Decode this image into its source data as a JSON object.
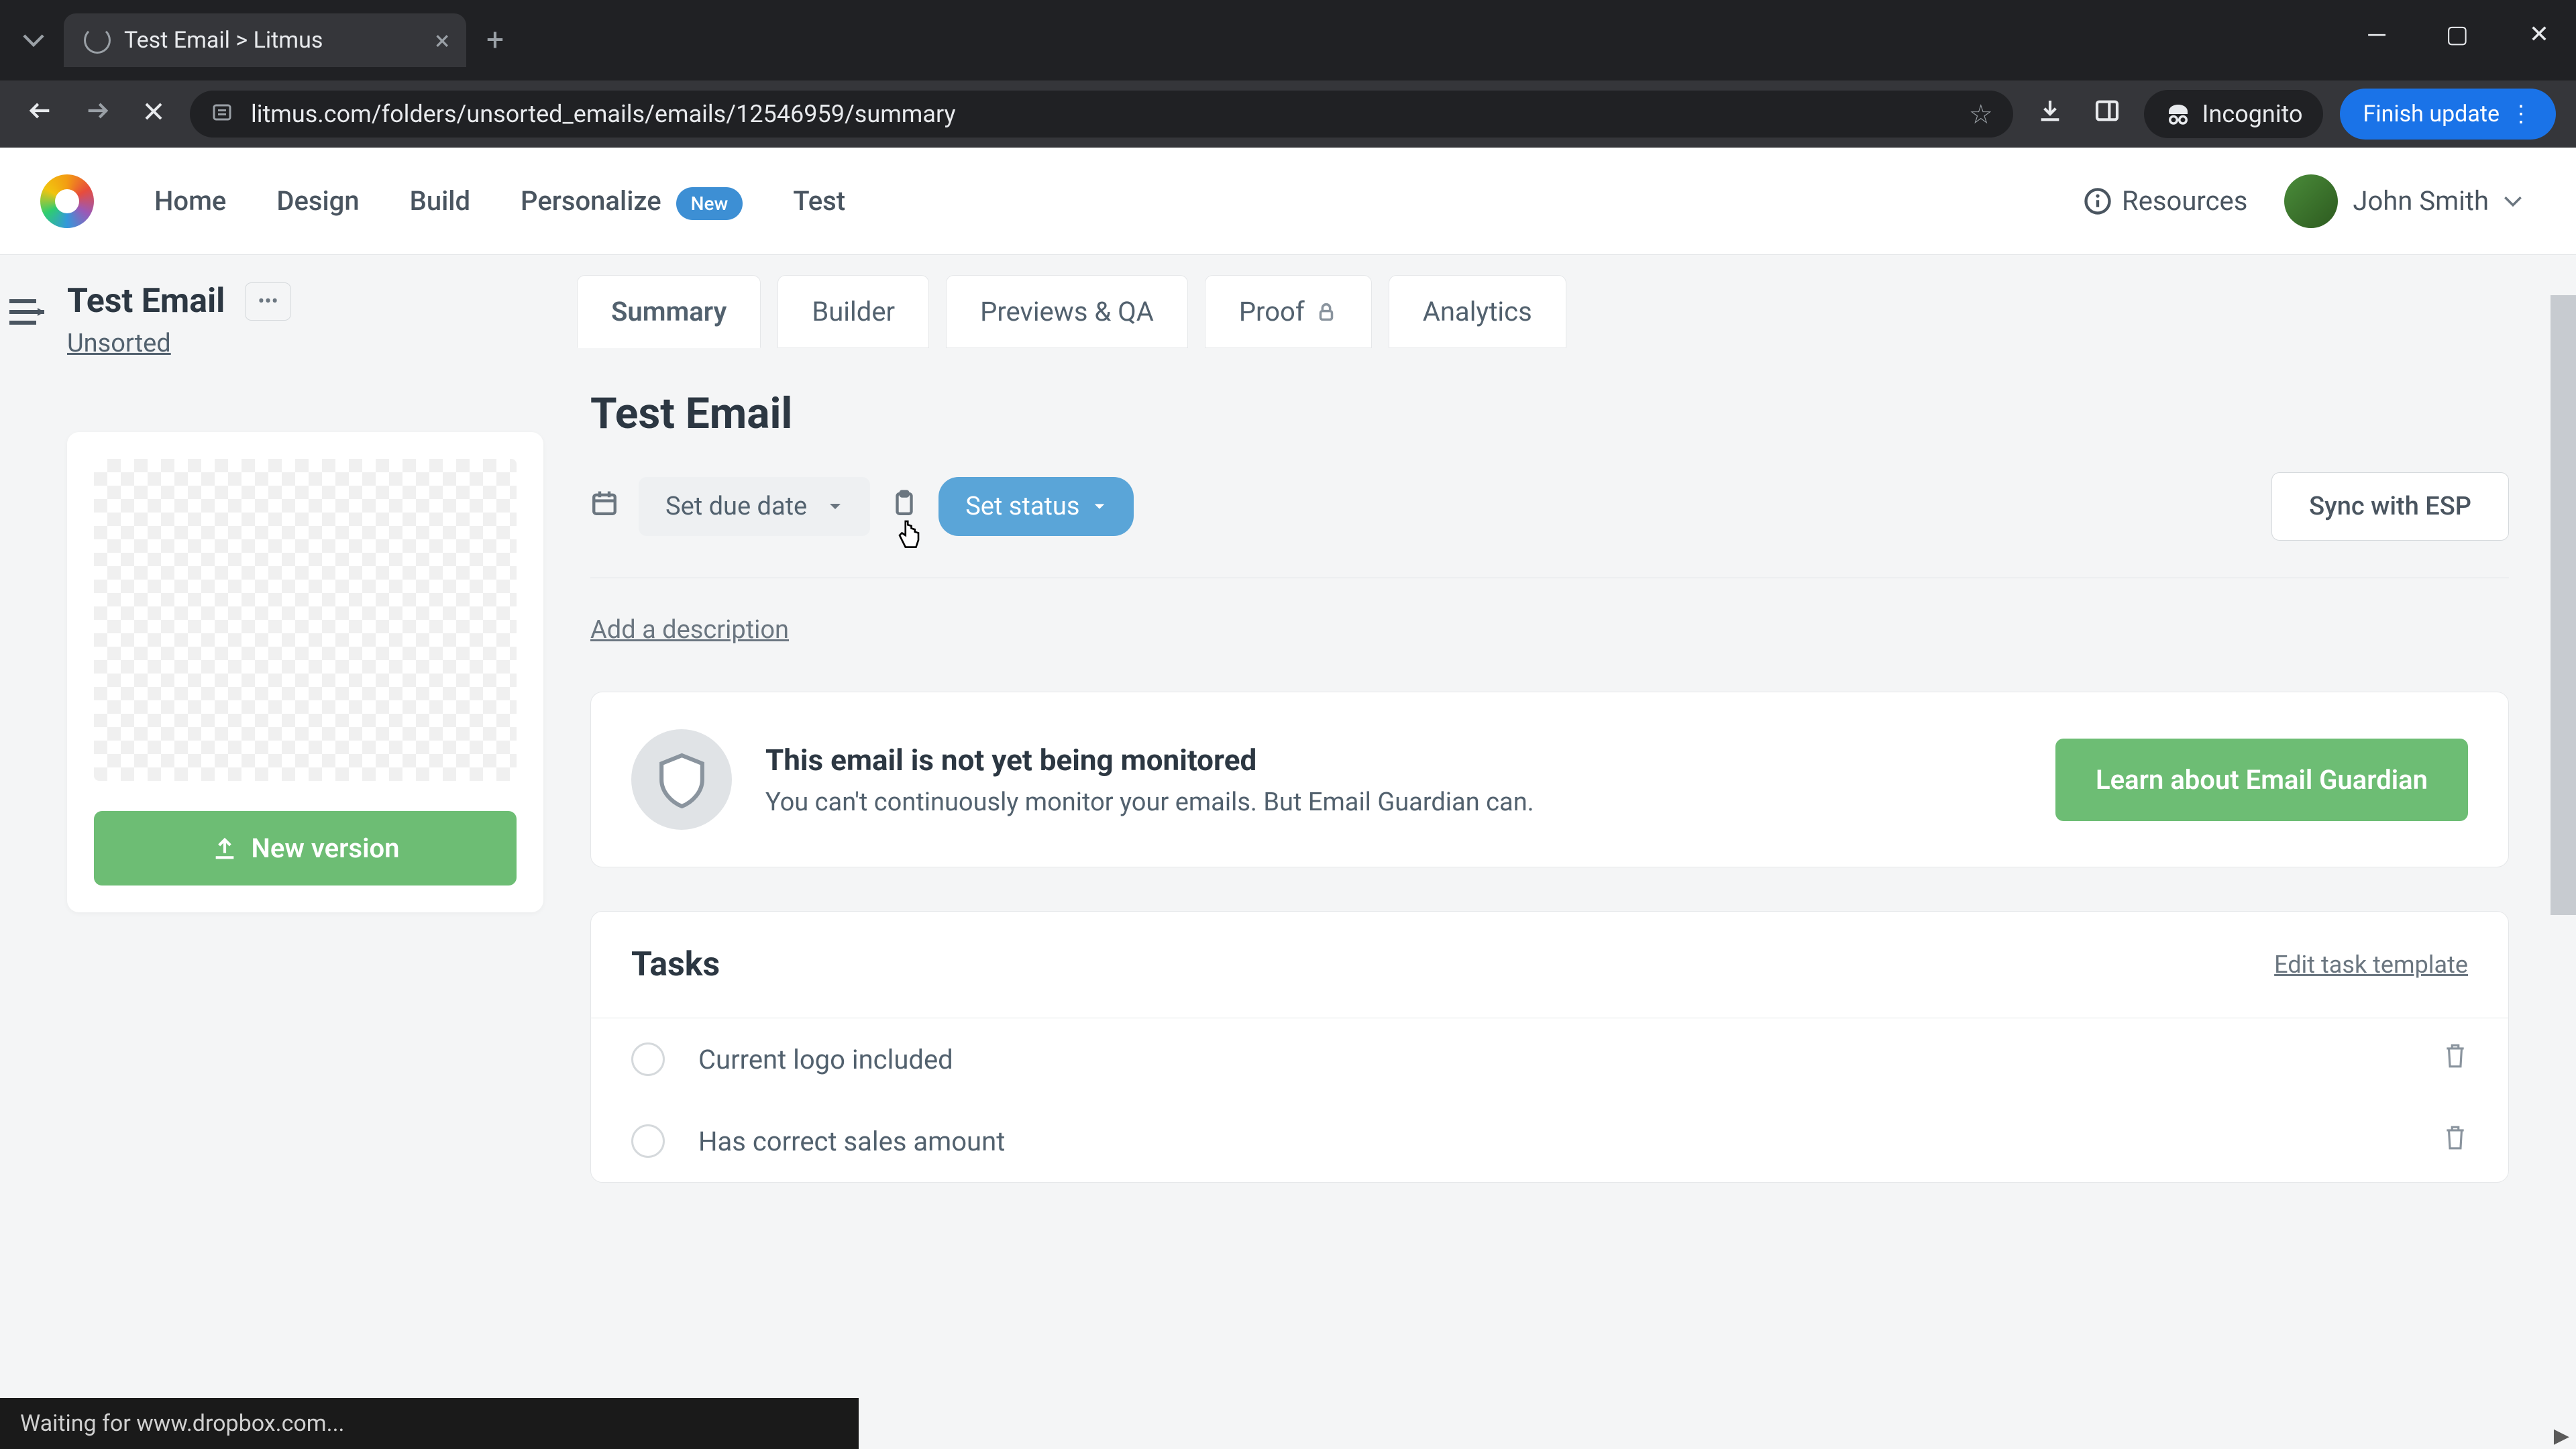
{
  "browser": {
    "tab_title": "Test Email > Litmus",
    "url": "litmus.com/folders/unsorted_emails/emails/12546959/summary",
    "incognito_label": "Incognito",
    "finish_update_label": "Finish update"
  },
  "header": {
    "nav": {
      "home": "Home",
      "design": "Design",
      "build": "Build",
      "personalize": "Personalize",
      "personalize_badge": "New",
      "test": "Test"
    },
    "resources_label": "Resources",
    "user_name": "John Smith"
  },
  "left_panel": {
    "title": "Test Email",
    "folder": "Unsorted",
    "new_version_label": "New version"
  },
  "tabs": {
    "summary": "Summary",
    "builder": "Builder",
    "previews": "Previews & QA",
    "proof": "Proof",
    "analytics": "Analytics"
  },
  "content": {
    "title": "Test Email",
    "due_date_label": "Set due date",
    "status_label": "Set status",
    "sync_label": "Sync with ESP",
    "add_description": "Add a description"
  },
  "guardian": {
    "title": "This email is not yet being monitored",
    "subtitle": "You can't continuously monitor your emails. But Email Guardian can.",
    "cta": "Learn about Email Guardian"
  },
  "tasks": {
    "heading": "Tasks",
    "edit_link": "Edit task template",
    "items": [
      {
        "label": "Current logo included"
      },
      {
        "label": "Has correct sales amount"
      }
    ]
  },
  "status_bar": "Waiting for www.dropbox.com..."
}
